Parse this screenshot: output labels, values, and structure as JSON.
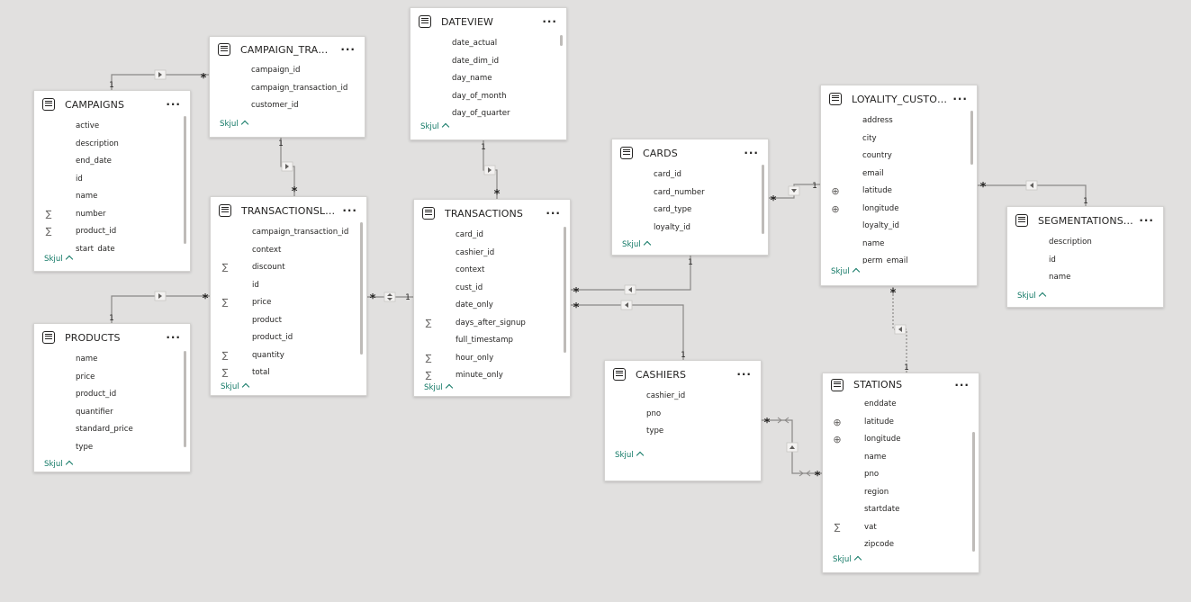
{
  "tables": [
    {
      "id": "campaigns",
      "title": "CAMPAIGNS",
      "collapse": "Skjul",
      "fields": [
        {
          "name": "active",
          "icon": ""
        },
        {
          "name": "description",
          "icon": ""
        },
        {
          "name": "end_date",
          "icon": ""
        },
        {
          "name": "id",
          "icon": ""
        },
        {
          "name": "name",
          "icon": ""
        },
        {
          "name": "number",
          "icon": "sigma-icon"
        },
        {
          "name": "product_id",
          "icon": "sigma-icon"
        },
        {
          "name": "start_date",
          "icon": ""
        }
      ]
    },
    {
      "id": "campaign_transactions",
      "title": "CAMPAIGN_TRANSACTI...",
      "collapse": "Skjul",
      "fields": [
        {
          "name": "campaign_id",
          "icon": ""
        },
        {
          "name": "campaign_transaction_id",
          "icon": ""
        },
        {
          "name": "customer_id",
          "icon": ""
        }
      ]
    },
    {
      "id": "dateview",
      "title": "DATEVIEW",
      "collapse": "Skjul",
      "fields": [
        {
          "name": "date_actual",
          "icon": ""
        },
        {
          "name": "date_dim_id",
          "icon": ""
        },
        {
          "name": "day_name",
          "icon": ""
        },
        {
          "name": "day_of_month",
          "icon": ""
        },
        {
          "name": "day_of_quarter",
          "icon": ""
        }
      ]
    },
    {
      "id": "transactionslines",
      "title": "TRANSACTIONSLINES",
      "collapse": "Skjul",
      "fields": [
        {
          "name": "campaign_transaction_id",
          "icon": ""
        },
        {
          "name": "context",
          "icon": ""
        },
        {
          "name": "discount",
          "icon": "sigma-icon"
        },
        {
          "name": "id",
          "icon": ""
        },
        {
          "name": "price",
          "icon": "sigma-icon"
        },
        {
          "name": "product",
          "icon": ""
        },
        {
          "name": "product_id",
          "icon": ""
        },
        {
          "name": "quantity",
          "icon": "sigma-icon"
        },
        {
          "name": "total",
          "icon": "sigma-icon"
        }
      ]
    },
    {
      "id": "products",
      "title": "PRODUCTS",
      "collapse": "Skjul",
      "fields": [
        {
          "name": "name",
          "icon": ""
        },
        {
          "name": "price",
          "icon": ""
        },
        {
          "name": "product_id",
          "icon": ""
        },
        {
          "name": "quantifier",
          "icon": ""
        },
        {
          "name": "standard_price",
          "icon": ""
        },
        {
          "name": "type",
          "icon": ""
        }
      ]
    },
    {
      "id": "transactions",
      "title": "TRANSACTIONS",
      "collapse": "Skjul",
      "fields": [
        {
          "name": "card_id",
          "icon": ""
        },
        {
          "name": "cashier_id",
          "icon": ""
        },
        {
          "name": "context",
          "icon": ""
        },
        {
          "name": "cust_id",
          "icon": ""
        },
        {
          "name": "date_only",
          "icon": ""
        },
        {
          "name": "days_after_signup",
          "icon": "sigma-icon"
        },
        {
          "name": "full_timestamp",
          "icon": ""
        },
        {
          "name": "hour_only",
          "icon": "sigma-icon"
        },
        {
          "name": "minute_only",
          "icon": "sigma-icon"
        }
      ]
    },
    {
      "id": "cards",
      "title": "CARDS",
      "collapse": "Skjul",
      "fields": [
        {
          "name": "card_id",
          "icon": ""
        },
        {
          "name": "card_number",
          "icon": ""
        },
        {
          "name": "card_type",
          "icon": ""
        },
        {
          "name": "loyalty_id",
          "icon": ""
        }
      ]
    },
    {
      "id": "loyality_customers",
      "title": "LOYALITY_CUSTOMERS",
      "collapse": "Skjul",
      "fields": [
        {
          "name": "address",
          "icon": ""
        },
        {
          "name": "city",
          "icon": ""
        },
        {
          "name": "country",
          "icon": ""
        },
        {
          "name": "email",
          "icon": ""
        },
        {
          "name": "latitude",
          "icon": "globe-icon"
        },
        {
          "name": "longitude",
          "icon": "globe-icon"
        },
        {
          "name": "loyalty_id",
          "icon": ""
        },
        {
          "name": "name",
          "icon": ""
        },
        {
          "name": "perm_email",
          "icon": ""
        }
      ]
    },
    {
      "id": "segmentations",
      "title": "SEGMENTATIONSGROU...",
      "collapse": "Skjul",
      "fields": [
        {
          "name": "description",
          "icon": ""
        },
        {
          "name": "id",
          "icon": ""
        },
        {
          "name": "name",
          "icon": ""
        }
      ]
    },
    {
      "id": "cashiers",
      "title": "CASHIERS",
      "collapse": "Skjul",
      "fields": [
        {
          "name": "cashier_id",
          "icon": ""
        },
        {
          "name": "pno",
          "icon": ""
        },
        {
          "name": "type",
          "icon": ""
        }
      ]
    },
    {
      "id": "stations",
      "title": "STATIONS",
      "collapse": "Skjul",
      "fields": [
        {
          "name": "enddate",
          "icon": ""
        },
        {
          "name": "latitude",
          "icon": "globe-icon"
        },
        {
          "name": "longitude",
          "icon": "globe-icon"
        },
        {
          "name": "name",
          "icon": ""
        },
        {
          "name": "pno",
          "icon": ""
        },
        {
          "name": "region",
          "icon": ""
        },
        {
          "name": "startdate",
          "icon": ""
        },
        {
          "name": "vat",
          "icon": "sigma-icon"
        },
        {
          "name": "zipcode",
          "icon": ""
        }
      ]
    }
  ],
  "relationships": [
    {
      "from": "campaigns",
      "to": "campaign_transactions",
      "from_card": "1",
      "to_card": "*",
      "direction": "single"
    },
    {
      "from": "campaign_transactions",
      "to": "transactionslines",
      "from_card": "1",
      "to_card": "*",
      "direction": "single"
    },
    {
      "from": "products",
      "to": "transactionslines",
      "from_card": "1",
      "to_card": "*",
      "direction": "single"
    },
    {
      "from": "transactions",
      "to": "transactionslines",
      "from_card": "1",
      "to_card": "*",
      "direction": "both"
    },
    {
      "from": "dateview",
      "to": "transactions",
      "from_card": "1",
      "to_card": "*",
      "direction": "single"
    },
    {
      "from": "cards",
      "to": "transactions",
      "from_card": "1",
      "to_card": "*",
      "direction": "single"
    },
    {
      "from": "cashiers",
      "to": "transactions",
      "from_card": "1",
      "to_card": "*",
      "direction": "single"
    },
    {
      "from": "loyality_customers",
      "to": "cards",
      "from_card": "1",
      "to_card": "*",
      "direction": "single"
    },
    {
      "from": "segmentations",
      "to": "loyality_customers",
      "from_card": "1",
      "to_card": "*",
      "direction": "single"
    },
    {
      "from": "stations",
      "to": "loyality_customers",
      "from_card": "1",
      "to_card": "*",
      "direction": "single",
      "inactive": true
    },
    {
      "from": "cashiers",
      "to": "stations",
      "from_card": "*",
      "to_card": "*",
      "direction": "single"
    }
  ],
  "colors": {
    "canvas": "#e1e0df",
    "card": "#ffffff",
    "accent": "#117865",
    "line": "#8a8886",
    "text": "#252423"
  },
  "icons": {
    "table": "table-icon",
    "more": "more-options-icon",
    "sigma": "sigma-icon",
    "globe": "globe-icon",
    "collapse": "chevron-up-icon"
  }
}
